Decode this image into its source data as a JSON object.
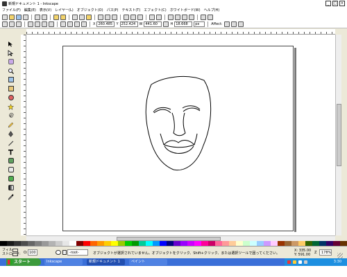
{
  "window": {
    "title": "新規ドキュメント 1 - Inkscape"
  },
  "menu": [
    "ファイル(F)",
    "編集(E)",
    "表示(V)",
    "レイヤー(L)",
    "オブジェクト(O)",
    "パス(P)",
    "テキスト(T)",
    "エフェクト(C)",
    "ホワイトボード(W)",
    "ヘルプ(H)"
  ],
  "tool_controls": {
    "x_label": "X",
    "x_value": "260.485",
    "y_label": "Y",
    "y_value": "252.424",
    "w_label": "W",
    "w_value": "441.60",
    "h_label": "H",
    "h_value": "18.668",
    "unit": "px",
    "affect_label": "Affect:"
  },
  "status": {
    "fill_label": "フィル:",
    "stroke_label": "ストローク:",
    "opacity_label": "O:",
    "opacity_value": "100",
    "layer_name": "-root-",
    "message": "オブジェクトが選択されていません。オブジェクトをクリック、Shift+クリック、または選択ツールで囲ってください。",
    "coord_x": "X: 335.00",
    "coord_y": "Y: 591.00",
    "zoom_label": "Z",
    "zoom_value": "178%"
  },
  "taskbar": {
    "start_label": "スタート",
    "tasks": [
      {
        "label": "Inkscape"
      },
      {
        "label": "新規ドキュメント 1"
      },
      {
        "label": "ペイント"
      }
    ],
    "clock": "3:30"
  },
  "palette": [
    "#000000",
    "#1a1a1a",
    "#333333",
    "#4d4d4d",
    "#666666",
    "#808080",
    "#999999",
    "#b3b3b3",
    "#cccccc",
    "#e6e6e6",
    "#ffffff",
    "#800000",
    "#ff0000",
    "#ff6600",
    "#ff9900",
    "#ffcc00",
    "#ffff00",
    "#99cc00",
    "#00cc00",
    "#009900",
    "#00cc99",
    "#00ffff",
    "#0099ff",
    "#0000ff",
    "#000080",
    "#6600cc",
    "#9900ff",
    "#cc00ff",
    "#ff00ff",
    "#ff0099",
    "#cc0066",
    "#ff6699",
    "#ff9999",
    "#ffcc99",
    "#ffffcc",
    "#ccffcc",
    "#ccffff",
    "#99ccff",
    "#cc99ff",
    "#ffccff",
    "#993300",
    "#996633",
    "#cc9966",
    "#ffcc66",
    "#336600",
    "#006633",
    "#003366",
    "#330066",
    "#660033",
    "#663300"
  ],
  "colors": {
    "title_bar": "#ffffff",
    "taskbar": "#3a6fd8",
    "start_button": "#3c9a3c",
    "tray": "#1d8fe0"
  }
}
